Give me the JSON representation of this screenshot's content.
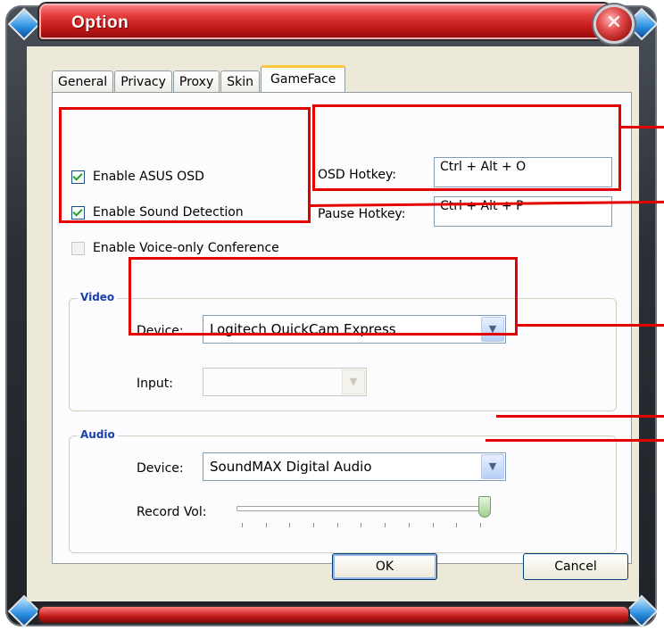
{
  "window": {
    "title": "Option",
    "close_symbol": "✕"
  },
  "tabs": [
    {
      "label": "General",
      "active": false
    },
    {
      "label": "Privacy",
      "active": false
    },
    {
      "label": "Proxy",
      "active": false
    },
    {
      "label": "Skin",
      "active": false
    },
    {
      "label": "GameFace",
      "active": true
    }
  ],
  "osd": {
    "enable_asus_osd": {
      "label": "Enable ASUS OSD",
      "checked": true
    },
    "enable_sound_detection": {
      "label": "Enable Sound Detection",
      "checked": true
    },
    "enable_voice_only": {
      "label": "Enable Voice-only Conference",
      "checked": false
    },
    "osd_hotkey_label": "OSD Hotkey:",
    "osd_hotkey_value": "Ctrl + Alt + O",
    "pause_hotkey_label": "Pause Hotkey:",
    "pause_hotkey_value": "Ctrl + Alt + P"
  },
  "video": {
    "legend": "Video",
    "device_label": "Device:",
    "device_value": "Logitech QuickCam Express",
    "input_label": "Input:",
    "input_value": ""
  },
  "audio": {
    "legend": "Audio",
    "device_label": "Device:",
    "device_value": "SoundMAX Digital Audio",
    "record_vol_label": "Record Vol:",
    "record_vol_level": 1.0
  },
  "buttons": {
    "ok": "OK",
    "cancel": "Cancel"
  },
  "colors": {
    "titlebar": "#c01818",
    "highlight": "#e50000",
    "active_tab": "#ffc83c"
  }
}
